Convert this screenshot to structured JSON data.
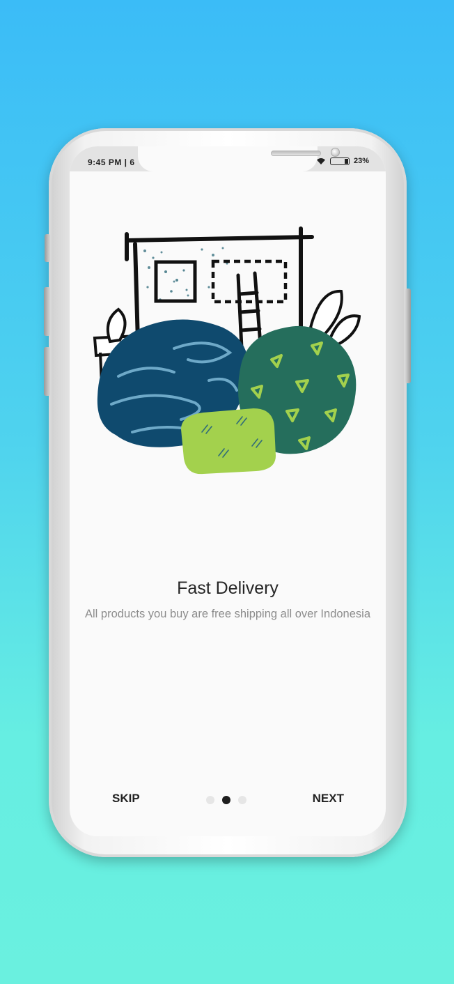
{
  "status_bar": {
    "time": "9:45 PM | 6",
    "battery": "23%",
    "icons": [
      "wifi-icon",
      "battery-icon"
    ]
  },
  "onboarding": {
    "illustration": "delivery-illustration",
    "title": "Fast Delivery",
    "subtitle": "All products you buy are free shipping all over Indonesia",
    "page_indicator": {
      "total": 3,
      "current": 2
    }
  },
  "navigation": {
    "skip_label": "SKIP",
    "next_label": "NEXT"
  },
  "colors": {
    "background_top": "#3bbcf7",
    "background_bottom": "#6af0df",
    "screen": "#fafafa",
    "text_primary": "#262626",
    "text_secondary": "#8c8c8c",
    "dot_active": "#1e1e1e",
    "dot_inactive": "#e6e6e6",
    "illustration_navy": "#0f4a6e",
    "illustration_teal": "#256e5c",
    "illustration_lime": "#a3d14d"
  }
}
